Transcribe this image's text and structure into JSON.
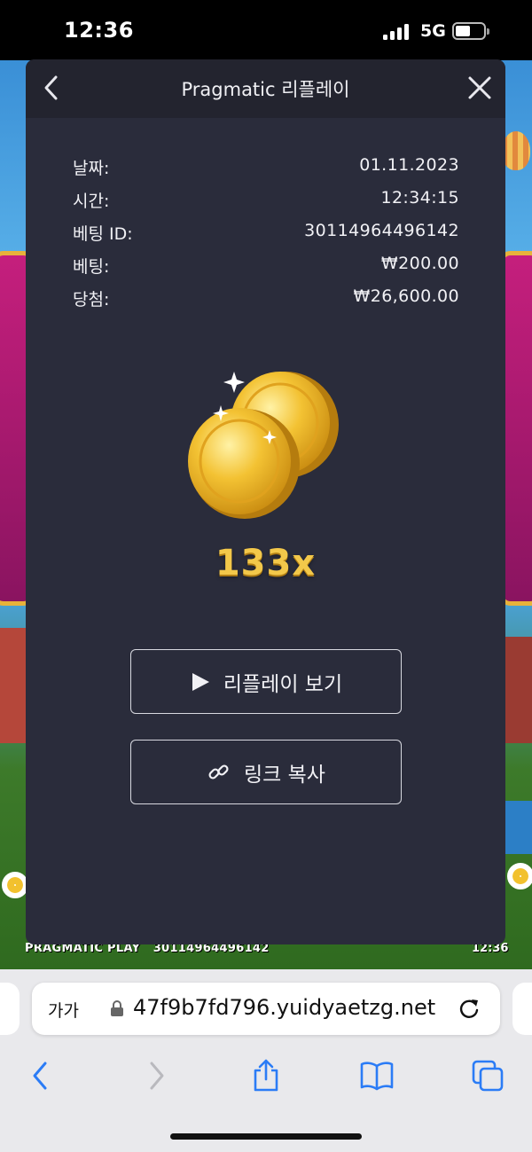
{
  "status_bar": {
    "time": "12:36",
    "network": "5G"
  },
  "game": {
    "footer_brand": "PRAGMATIC PLAY",
    "footer_bet_id": "30114964496142",
    "footer_time": "12:36"
  },
  "modal": {
    "title": "Pragmatic 리플레이",
    "rows": [
      {
        "label": "날짜:",
        "value": "01.11.2023"
      },
      {
        "label": "시간:",
        "value": "12:34:15"
      },
      {
        "label": "베팅 ID:",
        "value": "30114964496142"
      },
      {
        "label": "베팅:",
        "value": "₩200.00"
      },
      {
        "label": "당첨:",
        "value": "₩26,600.00"
      }
    ],
    "multiplier": "133x",
    "replay_button": "리플레이 보기",
    "copy_link_button": "링크 복사"
  },
  "browser": {
    "text_size_label": "가가",
    "url": "47f9b7fd796.yuidyaetzg.net"
  },
  "colors": {
    "modal_bg": "#2a2c3b",
    "header_bg": "#23242f",
    "accent_gold": "#f3c84a"
  },
  "icons": {
    "back": "chevron-left-icon",
    "close": "close-icon",
    "play": "play-icon",
    "link": "link-icon",
    "lock": "lock-icon",
    "reload": "reload-icon",
    "share": "share-icon",
    "bookmarks": "book-icon",
    "tabs": "tabs-icon"
  }
}
